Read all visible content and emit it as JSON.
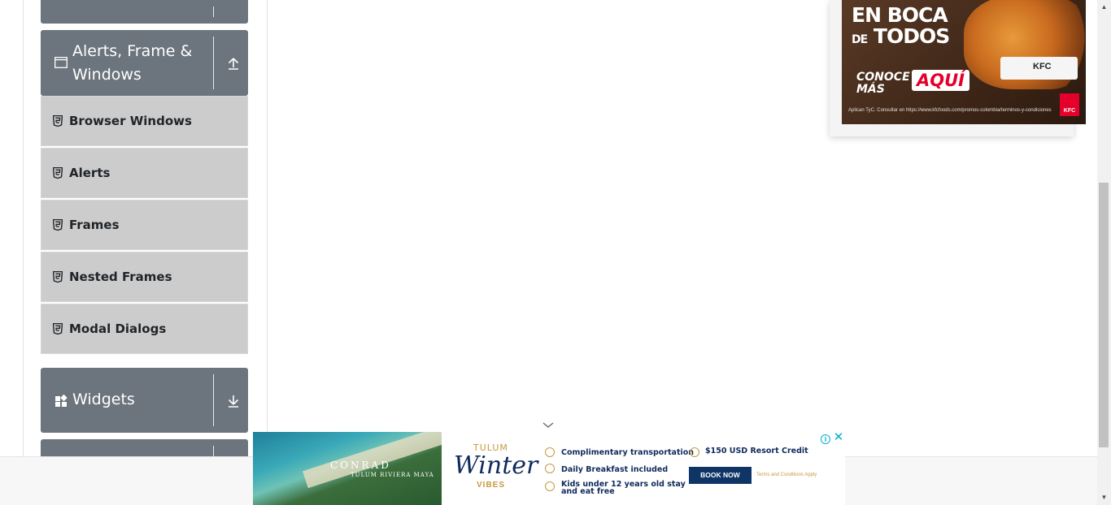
{
  "sidebar": {
    "groups": [
      {
        "title": ""
      },
      {
        "title": "Alerts, Frame & Windows",
        "toggle_icon": "arrow-up-icon",
        "icon": "window-icon"
      },
      {
        "title": "Widgets",
        "toggle_icon": "arrow-down-icon",
        "icon": "widgets-icon"
      }
    ],
    "items": [
      {
        "label": "Browser Windows",
        "icon": "html5-icon"
      },
      {
        "label": "Alerts",
        "icon": "html5-icon"
      },
      {
        "label": "Frames",
        "icon": "html5-icon"
      },
      {
        "label": "Nested Frames",
        "icon": "html5-icon"
      },
      {
        "label": "Modal Dialogs",
        "icon": "html5-icon"
      }
    ]
  },
  "top_ad": {
    "line1": "EN BOCA",
    "line2_small": "DE",
    "line2": "TODOS",
    "conoce": "CONOCE",
    "mas": "MÁS",
    "aqui": "AQUÍ",
    "brand": "KFC",
    "legal": "Aplican TyC. Consultar en https://www.kfcfoods.com/promos-colombia/terminos-y-condiciones"
  },
  "bottom_ad": {
    "brand": "CONRAD",
    "brand_sub": "TULUM RIVIERA MAYA",
    "tulum": "TULUM",
    "winter": "Winter",
    "vibes": "VIBES",
    "perks": [
      "Complimentary transportation",
      "Daily Breakfast included",
      "Kids under 12 years old stay",
      "and eat free"
    ],
    "credit": "$150 USD Resort Credit",
    "book_now": "BOOK NOW",
    "terms": "Terms and Conditions Apply",
    "info_icon": "info-icon",
    "close_icon": "close-icon"
  },
  "colors": {
    "group_header_bg": "#6c757d",
    "menu_item_bg": "#cccccc",
    "accent_navy": "#0f3466",
    "accent_gold": "#c7993f"
  }
}
